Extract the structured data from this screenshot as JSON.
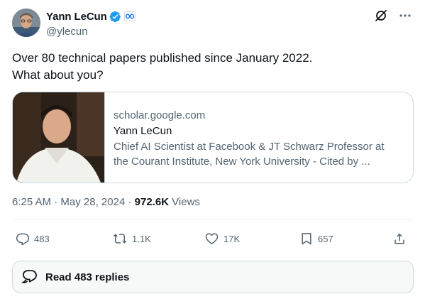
{
  "author": {
    "display_name": "Yann LeCun",
    "handle": "@ylecun",
    "verified": true,
    "affiliation_badge": "meta-infinity-icon"
  },
  "header_icons": [
    "grok-icon",
    "more-icon"
  ],
  "tweet": {
    "text_lines": [
      "Over 80 technical papers published since January 2022.",
      "What about you?"
    ]
  },
  "link_card": {
    "domain": "scholar.google.com",
    "title": "Yann LeCun",
    "description": "Chief AI Scientist at Facebook & JT Schwarz Professor at the Courant Institute, New York University - Cited by ..."
  },
  "meta": {
    "time": "6:25 AM",
    "separator": " · ",
    "date": "May 28, 2024",
    "views_count": "972.6K",
    "views_label": " Views"
  },
  "actions": {
    "replies": "483",
    "reposts": "1.1K",
    "likes": "17K",
    "bookmarks": "657"
  },
  "read_replies_label": "Read 483 replies",
  "colors": {
    "accent": "#1d9bf0",
    "text_primary": "#0f1419",
    "text_secondary": "#536471",
    "border": "#cfd9de"
  }
}
